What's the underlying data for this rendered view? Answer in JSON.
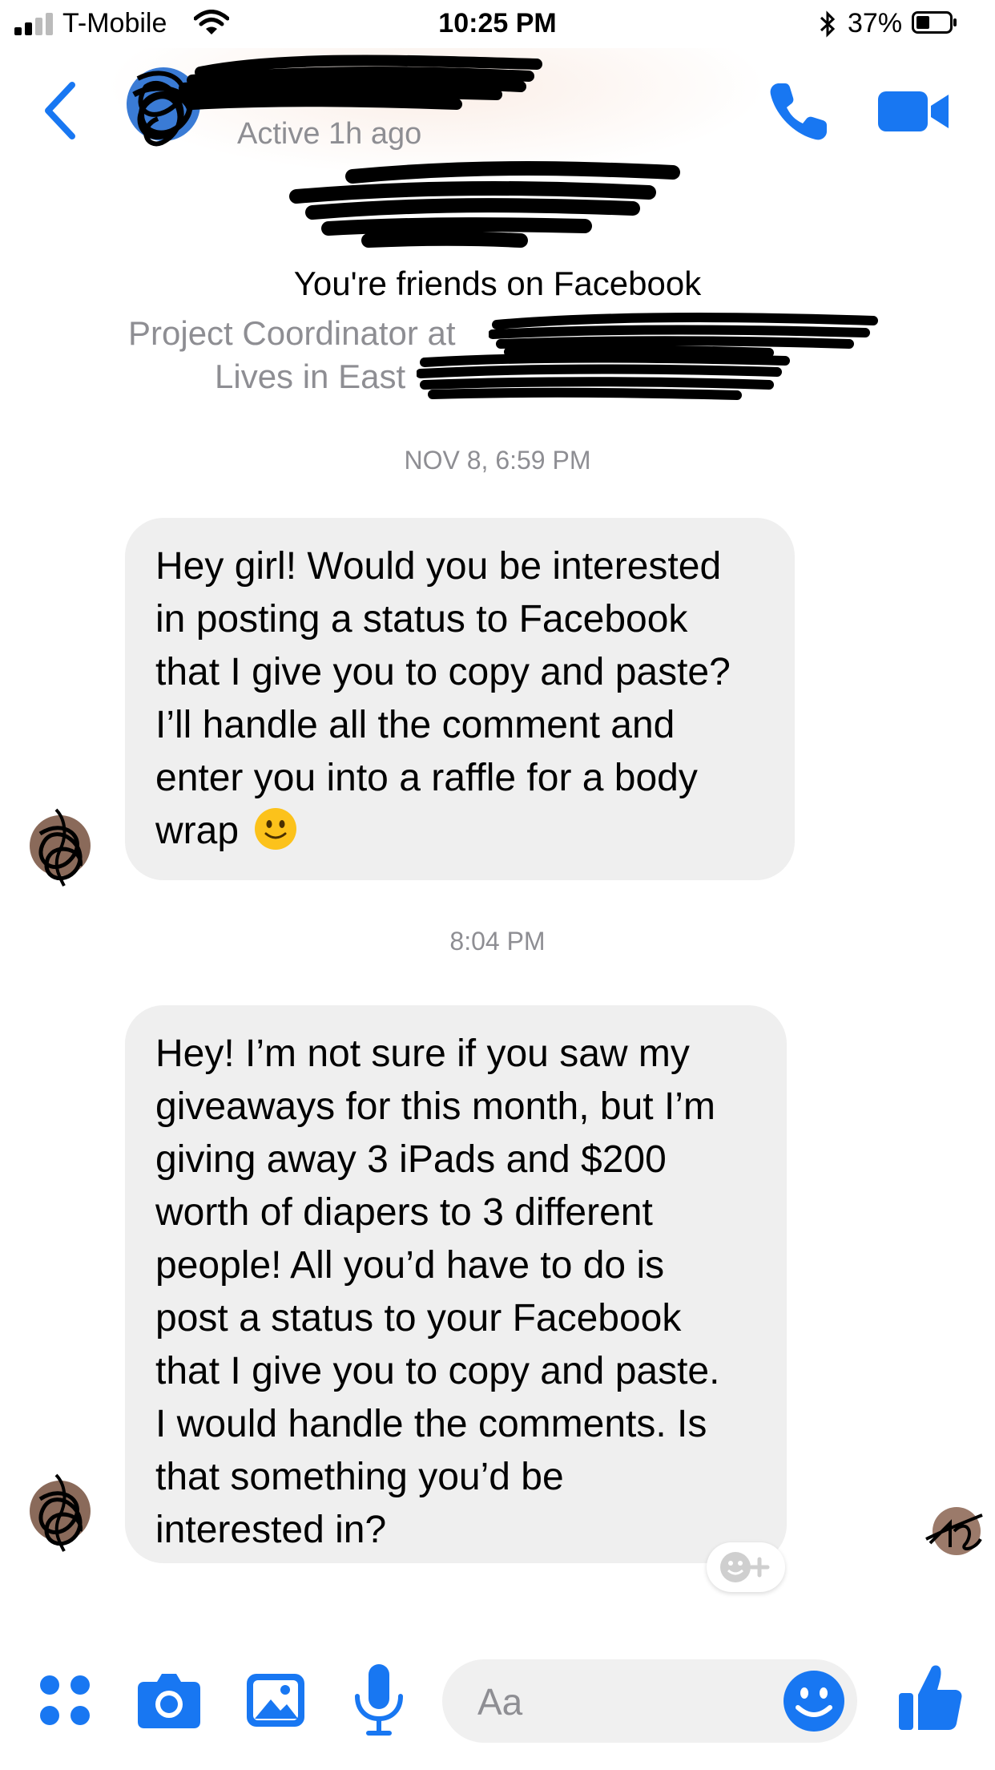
{
  "status_bar": {
    "carrier": "T-Mobile",
    "time": "10:25 PM",
    "battery": "37%"
  },
  "header": {
    "active_status": "Active 1h ago"
  },
  "profile": {
    "friends_note": "You're friends on Facebook",
    "job": "Project Coordinator at",
    "lives": "Lives in East"
  },
  "thread": {
    "timestamp_1": "NOV 8, 6:59 PM",
    "message_1": "Hey girl! Would you be interested\nin posting a status to Facebook\nthat I give you to copy and paste?\nI’ll handle all the comment and\nenter you into a raffle for a body\nwrap",
    "timestamp_2": "8:04 PM",
    "message_2": "Hey! I’m not sure if you saw my\ngiveaways for this month, but I’m\ngiving away 3 iPads and $200\nworth of diapers to 3 different\npeople! All you’d have to do is\npost a status to your Facebook\nthat I give you to copy and paste.\nI would handle the comments. Is\nthat something you’d be\ninterested in?"
  },
  "composer": {
    "placeholder": "Aa"
  },
  "colors": {
    "accent": "#1877f2",
    "bubble": "#efefef",
    "muted_text": "#8e8e93"
  },
  "icons": [
    "signal-icon",
    "wifi-icon",
    "bluetooth-icon",
    "battery-icon",
    "back-icon",
    "phone-icon",
    "video-icon",
    "smile-emoji-icon",
    "add-reaction-icon",
    "more-icon",
    "camera-icon",
    "photo-icon",
    "microphone-icon",
    "emoji-icon",
    "thumbs-up-icon"
  ]
}
